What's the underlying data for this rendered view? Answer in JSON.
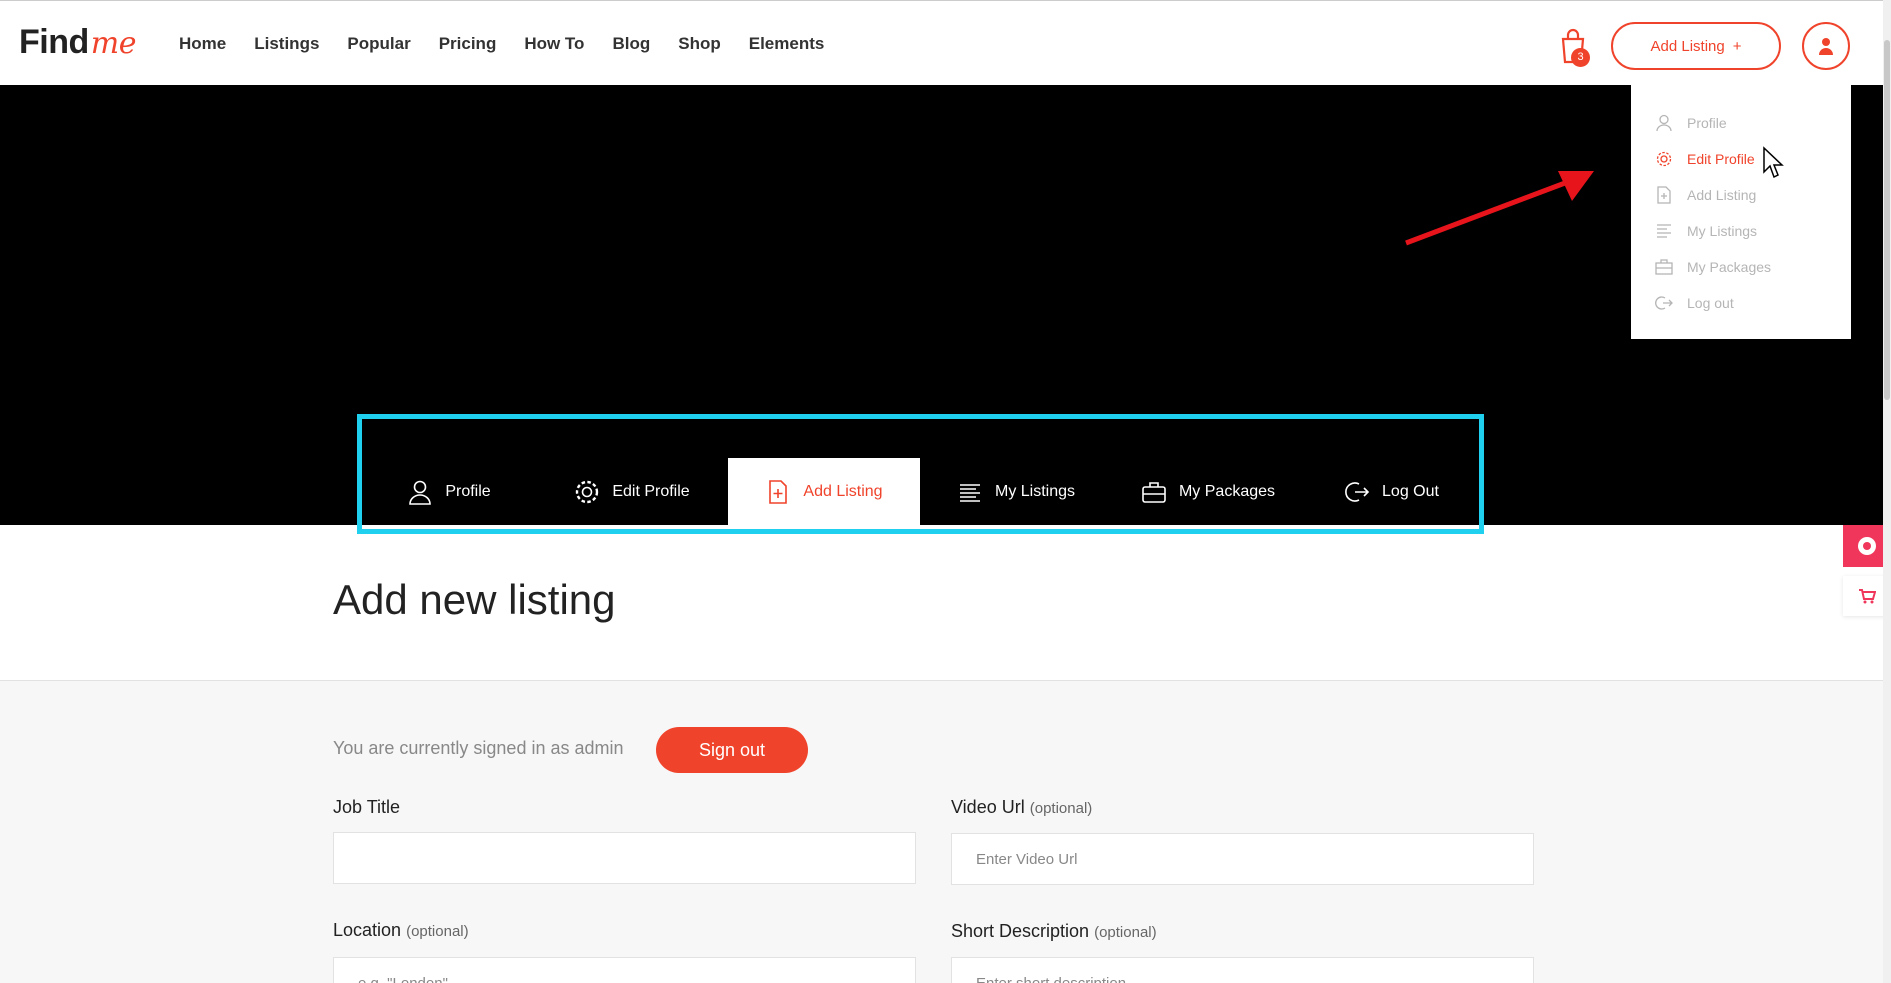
{
  "header": {
    "logo_main": "Find",
    "logo_script": "me",
    "nav": [
      "Home",
      "Listings",
      "Popular",
      "Pricing",
      "How To",
      "Blog",
      "Shop",
      "Elements"
    ],
    "cart_count": "3",
    "add_listing_label": "Add Listing",
    "add_listing_plus": "+"
  },
  "dropdown": {
    "items": [
      {
        "label": "Profile",
        "icon": "user-icon"
      },
      {
        "label": "Edit Profile",
        "icon": "gear-icon",
        "active": true
      },
      {
        "label": "Add Listing",
        "icon": "file-plus-icon"
      },
      {
        "label": "My Listings",
        "icon": "list-icon"
      },
      {
        "label": "My Packages",
        "icon": "briefcase-icon"
      },
      {
        "label": "Log out",
        "icon": "logout-icon"
      }
    ]
  },
  "tabs": [
    {
      "label": "Profile",
      "icon": "user-icon"
    },
    {
      "label": "Edit Profile",
      "icon": "gear-icon"
    },
    {
      "label": "Add Listing",
      "icon": "file-plus-icon",
      "active": true
    },
    {
      "label": "My Listings",
      "icon": "list-icon"
    },
    {
      "label": "My Packages",
      "icon": "briefcase-icon"
    },
    {
      "label": "Log Out",
      "icon": "logout-icon"
    }
  ],
  "page": {
    "title": "Add new listing",
    "signed_in_text": "You are currently signed in as admin",
    "sign_out_label": "Sign out"
  },
  "form": {
    "job_title": {
      "label": "Job Title",
      "value": ""
    },
    "video_url": {
      "label": "Video Url",
      "optional": "(optional)",
      "placeholder": "Enter Video Url"
    },
    "location": {
      "label": "Location",
      "optional": "(optional)",
      "placeholder": "e.g. \"London\""
    },
    "short_description": {
      "label": "Short Description",
      "optional": "(optional)",
      "placeholder": "Enter short description"
    }
  },
  "colors": {
    "accent": "#f0432b",
    "highlight_box": "#1fd0ef",
    "annotation_arrow": "#e8141c"
  }
}
